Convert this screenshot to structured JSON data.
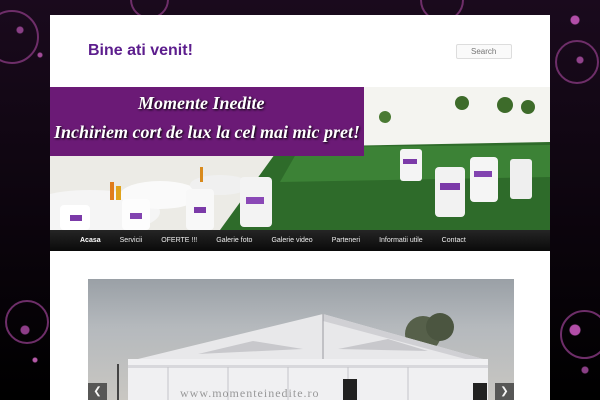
{
  "site": {
    "title": "Bine ati venit!",
    "search_placeholder": "Search"
  },
  "banner": {
    "line1": "Momente Inedite",
    "line2": "Inchiriem cort de lux la cel mai mic pret!"
  },
  "nav": {
    "items": [
      {
        "label": "Acasa",
        "active": true
      },
      {
        "label": "Servicii"
      },
      {
        "label": "OFERTE !!!"
      },
      {
        "label": "Galerie foto"
      },
      {
        "label": "Galerie video"
      },
      {
        "label": "Parteneri"
      },
      {
        "label": "Informatii utile"
      },
      {
        "label": "Contact"
      }
    ]
  },
  "slider": {
    "watermark": "www.momenteinedite.ro",
    "prev_icon": "chevron-left-icon",
    "next_icon": "chevron-right-icon"
  },
  "colors": {
    "title": "#5c1d8d",
    "banner": "#6b1a76",
    "nav_bg": "#1a1a1a"
  }
}
